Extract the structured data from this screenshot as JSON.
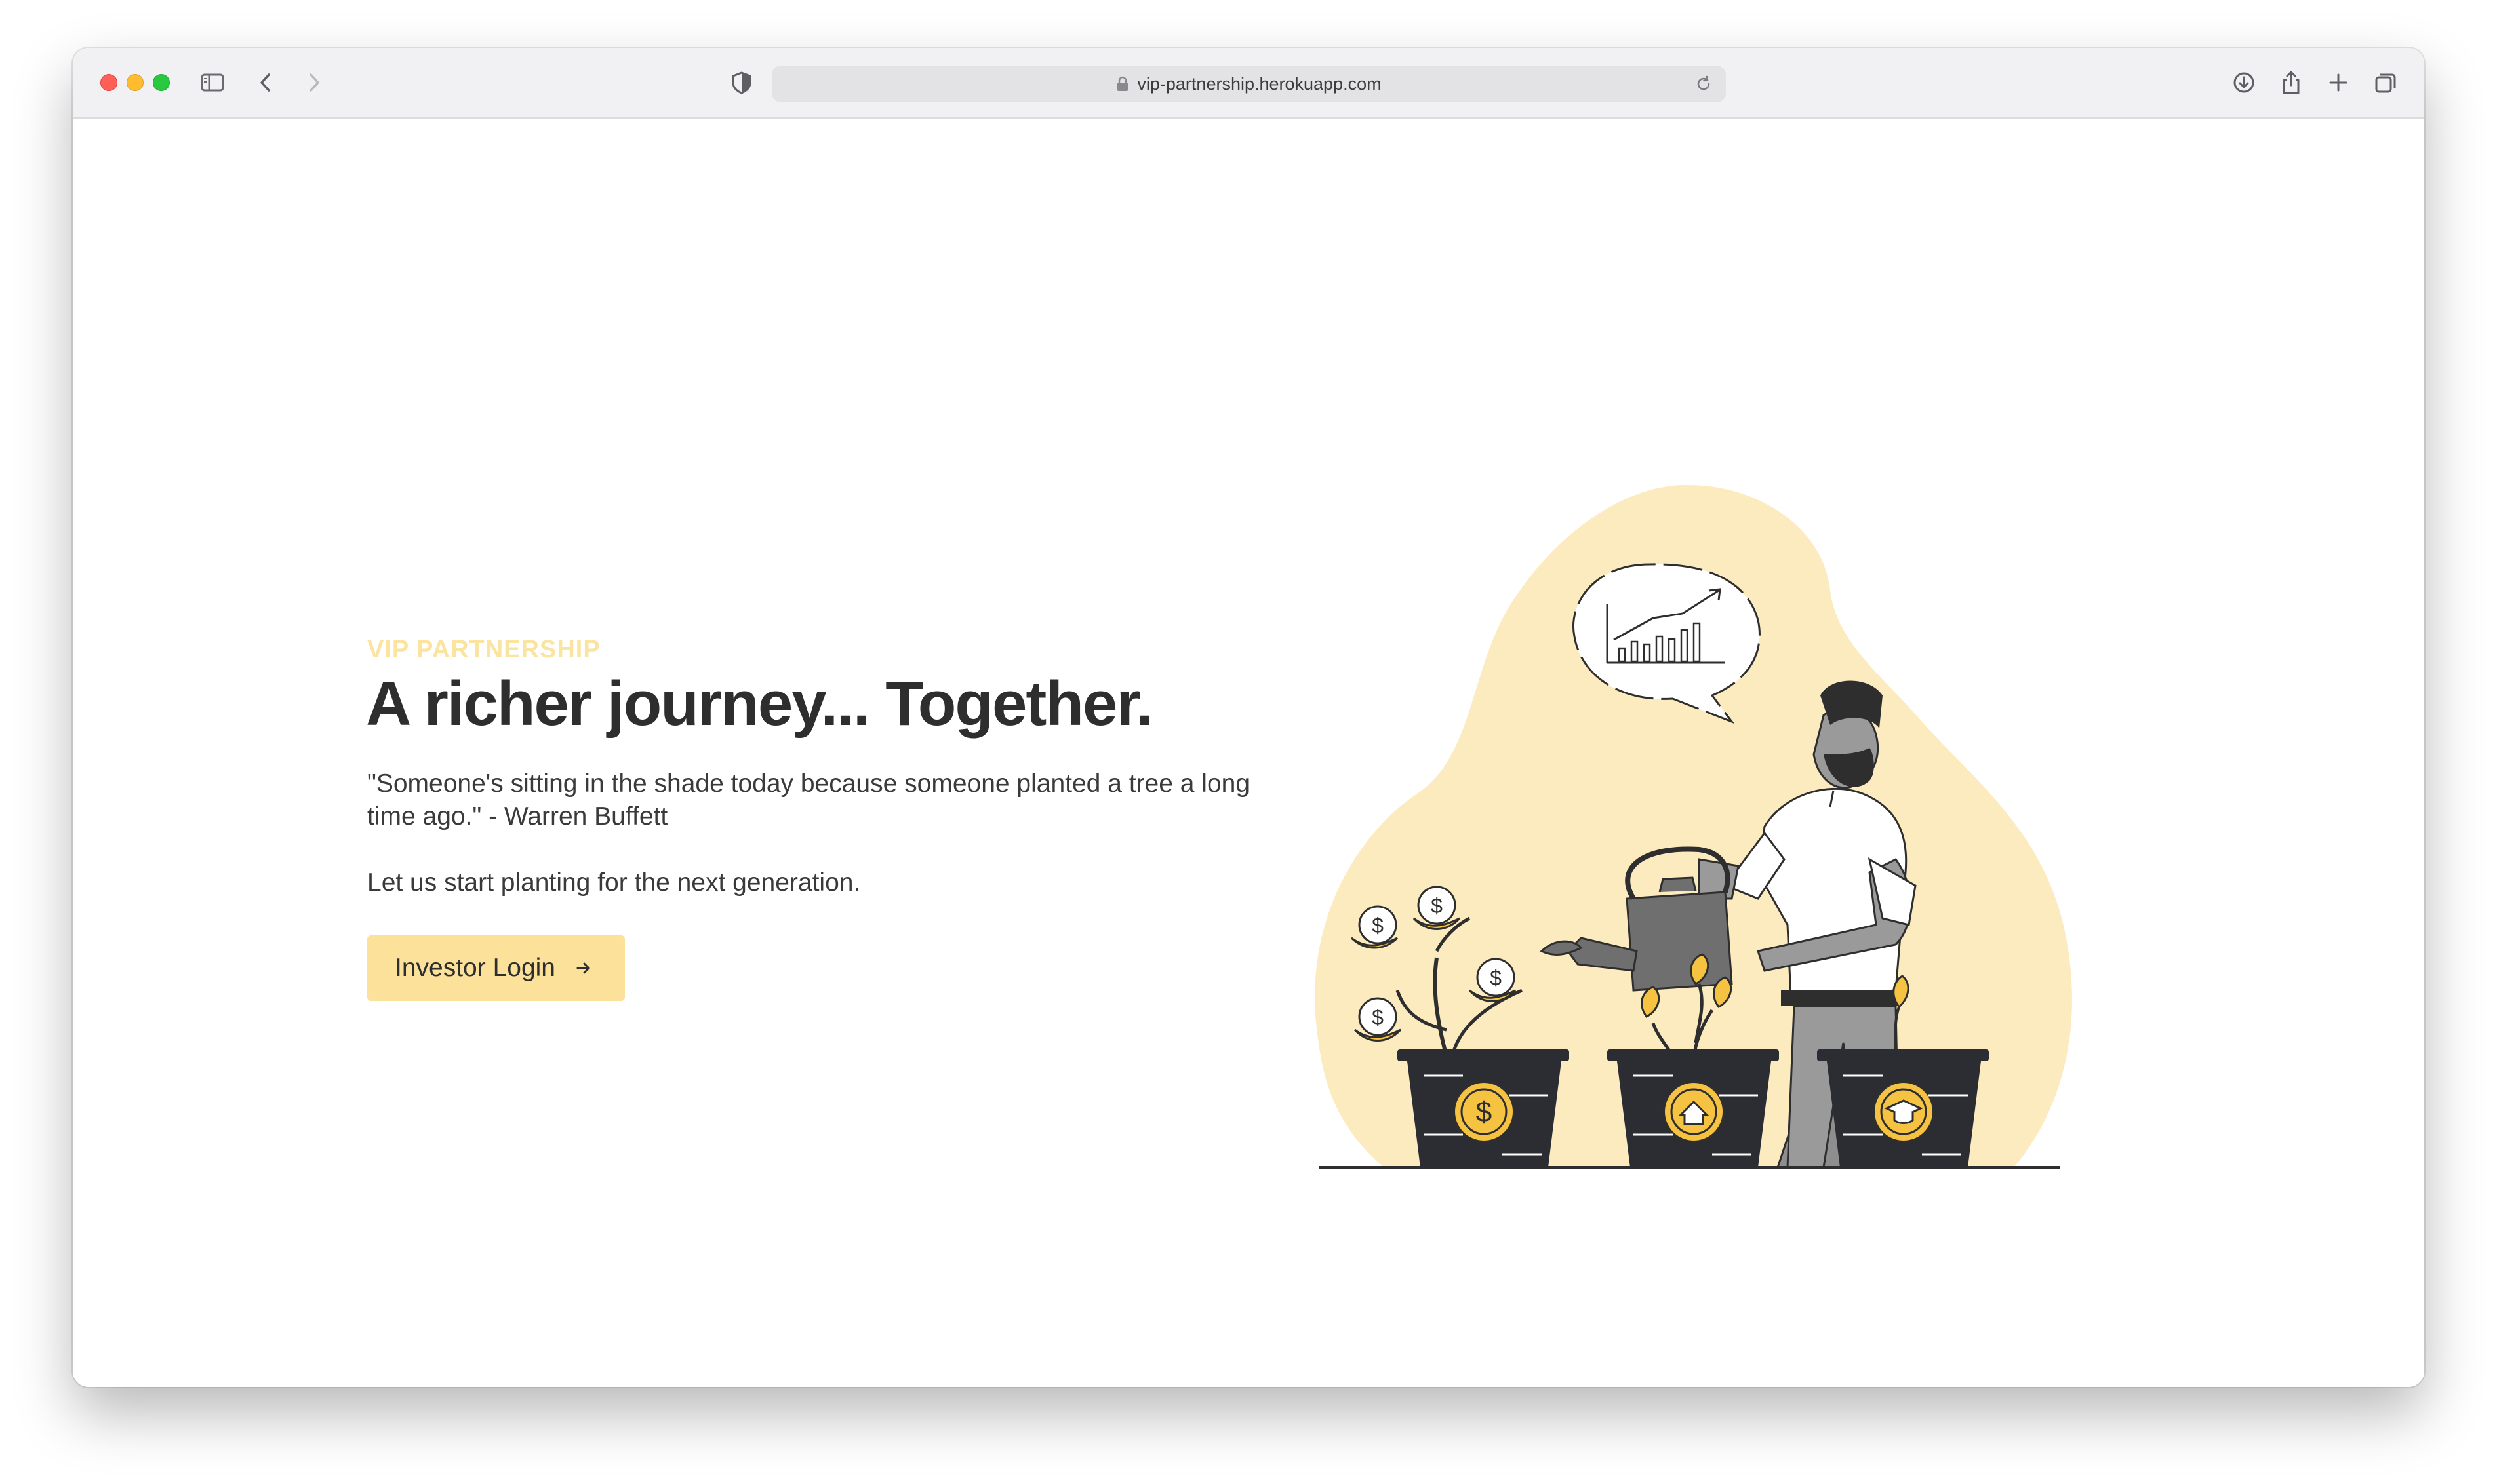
{
  "browser": {
    "url": "vip-partnership.herokuapp.com"
  },
  "hero": {
    "eyebrow": "VIP PARTNERSHIP",
    "headline": "A richer journey... Together.",
    "quote": "\"Someone's sitting in the shade today because someone planted a tree a long time ago.\" - Warren Buffett",
    "tagline": "Let us start planting for the next generation.",
    "cta_label": "Investor Login"
  },
  "colors": {
    "accent": "#fbe199",
    "eyebrow": "#fbe3a0",
    "blob": "#fdebc0",
    "coin": "#f5c242",
    "pot": "#2b2d33"
  },
  "icons": [
    "sidebar-icon",
    "back-icon",
    "forward-icon",
    "shield-icon",
    "lock-icon",
    "reload-icon",
    "download-icon",
    "share-icon",
    "new-tab-icon",
    "tabs-overview-icon",
    "arrow-right-icon"
  ]
}
